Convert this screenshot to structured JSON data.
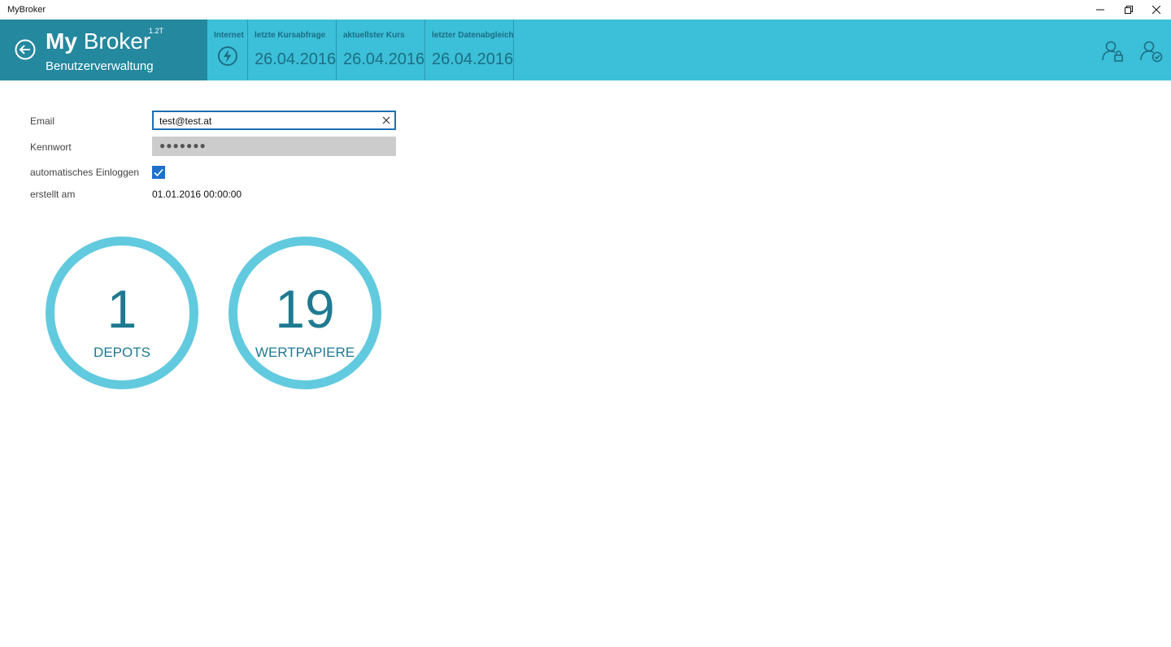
{
  "window": {
    "title": "MyBroker"
  },
  "header": {
    "brand_bold": "My",
    "brand_light": "Broker",
    "version": "1.2T",
    "subtitle": "Benutzerverwaltung",
    "stats": {
      "internet_label": "Internet",
      "kurs_label": "letzte Kursabfrage",
      "kurs_value": "26.04.2016",
      "aktuell_label": "aktuellster Kurs",
      "aktuell_value": "26.04.2016",
      "daten_label": "letzter Datenabgleich",
      "daten_value": "26.04.2016"
    }
  },
  "form": {
    "email_label": "Email",
    "email_value": "test@test.at",
    "password_label": "Kennwort",
    "password_mask": "●●●●●●●",
    "auto_login_label": "automatisches Einloggen",
    "auto_login_checked": true,
    "created_label": "erstellt am",
    "created_value": "01.01.2016 00:00:00"
  },
  "summary": {
    "depots_count": "1",
    "depots_label": "DEPOTS",
    "wertpapiere_count": "19",
    "wertpapiere_label": "WERTPAPIERE"
  },
  "colors": {
    "header_bg": "#3cbfd8",
    "brand_bg": "#24889e",
    "ring": "#62cade",
    "accent_text": "#1f7a91",
    "checkbox": "#1f6fcc"
  }
}
